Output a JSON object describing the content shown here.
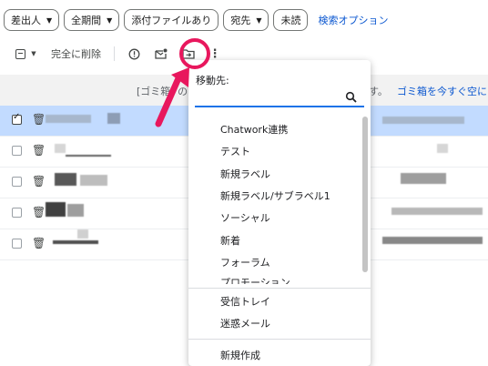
{
  "filters": {
    "chips": [
      {
        "label": "差出人",
        "has_caret": true
      },
      {
        "label": "全期間",
        "has_caret": true
      },
      {
        "label": "添付ファイルあり",
        "has_caret": false
      },
      {
        "label": "宛先",
        "has_caret": true
      },
      {
        "label": "未読",
        "has_caret": false
      }
    ],
    "search_options": "検索オプション"
  },
  "toolbar": {
    "delete_forever": "完全に削除"
  },
  "banner": {
    "left_text": "[ゴミ箱] の",
    "right_text": "す。",
    "empty_trash_link": "ゴミ箱を今すぐ空に"
  },
  "move_menu": {
    "title": "移動先:",
    "search_placeholder": "",
    "labels": [
      "Chatwork連携",
      "テスト",
      "新規ラベル",
      "新規ラベル/サブラベル1",
      "ソーシャル",
      "新着",
      "フォーラム",
      "プロモーション"
    ],
    "system": [
      "受信トレイ",
      "迷惑メール"
    ],
    "create_new": "新規作成"
  },
  "colors": {
    "accent_blue": "#0b57d0",
    "selected_row": "#c2dbff",
    "highlight": "#e8175d"
  }
}
